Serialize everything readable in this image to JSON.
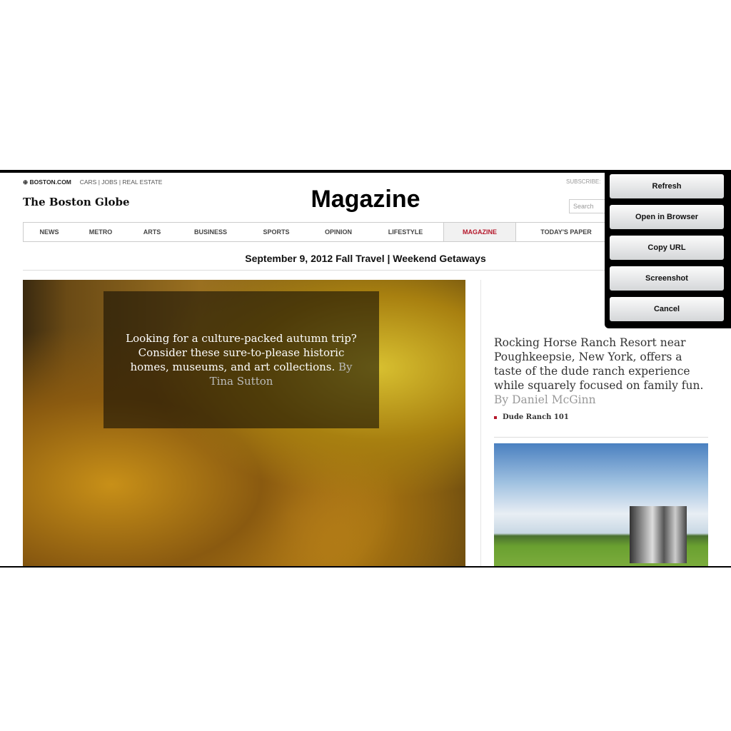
{
  "header": {
    "boston_com": "BOSTON.COM",
    "top_links": [
      "CARS",
      "JOBS",
      "REAL ESTATE"
    ],
    "logo": "The Boston Globe",
    "title": "Magazine",
    "subscribe": "SUBSCRIBE:",
    "search_placeholder": "Search"
  },
  "nav": {
    "items": [
      "NEWS",
      "METRO",
      "ARTS",
      "BUSINESS",
      "SPORTS",
      "OPINION",
      "LIFESTYLE",
      "MAGAZINE",
      "TODAY'S PAPER"
    ],
    "active": "MAGAZINE"
  },
  "dateline": "September 9, 2012 Fall Travel | Weekend Getaways",
  "hero": {
    "text": "Looking for a culture-packed autumn trip? Consider these sure-to-please historic homes, museums, and art collections.",
    "byline": "By Tina Sutton"
  },
  "side": {
    "text": "Rocking Horse Ranch Resort near Poughkeepsie, New York, offers a taste of the dude ranch experience while squarely focused on family fun.",
    "byline": "By Daniel McGinn",
    "link": "Dude Ranch 101"
  },
  "menu": {
    "items": [
      "Refresh",
      "Open in Browser",
      "Copy URL",
      "Screenshot",
      "Cancel"
    ]
  },
  "colors": {
    "accent": "#b5172a"
  }
}
